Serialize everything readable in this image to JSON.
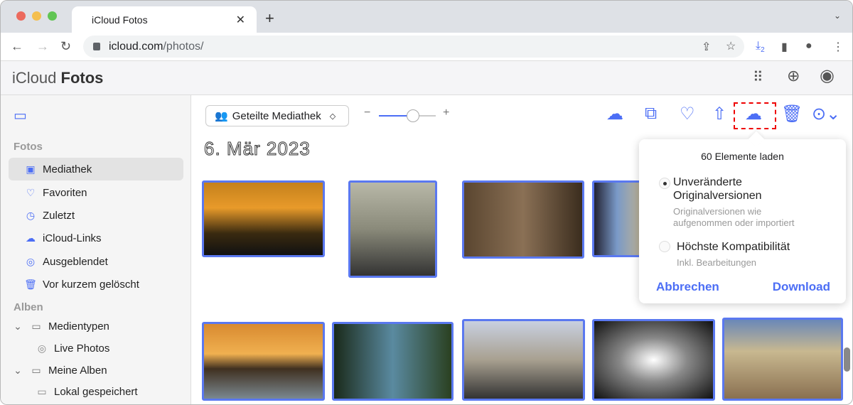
{
  "browser": {
    "tab_title": "iCloud Fotos",
    "url_host": "icloud.com",
    "url_path": "/photos/",
    "download_badge": "2"
  },
  "app": {
    "brand_prefix": "iCloud",
    "brand_name": "Fotos"
  },
  "sidebar": {
    "section_photos": "Fotos",
    "items": [
      {
        "label": "Mediathek",
        "icon": "photo-library-icon"
      },
      {
        "label": "Favoriten",
        "icon": "heart-icon"
      },
      {
        "label": "Zuletzt",
        "icon": "clock-icon"
      },
      {
        "label": "iCloud-Links",
        "icon": "link-icon"
      },
      {
        "label": "Ausgeblendet",
        "icon": "eye-slash-icon"
      },
      {
        "label": "Vor kurzem gelöscht",
        "icon": "trash-icon"
      }
    ],
    "section_albums": "Alben",
    "albums": [
      {
        "label": "Medientypen"
      },
      {
        "label": "Live Photos"
      },
      {
        "label": "Meine Alben"
      },
      {
        "label": "Lokal gespeichert"
      }
    ]
  },
  "toolbar": {
    "library_select": "Geteilte Mediathek",
    "zoom_level": 0.6
  },
  "main": {
    "date_heading": "6. Mär 2023"
  },
  "popover": {
    "title": "60 Elemente laden",
    "option1": "Unveränderte Originalversionen",
    "option1_sub": "Originalversionen wie aufgenommen oder importiert",
    "option2": "Höchste Kompatibilität",
    "option2_sub": "Inkl. Bearbeitungen",
    "cancel": "Abbrechen",
    "download": "Download"
  },
  "colors": {
    "accent": "#4c6ef5",
    "highlight": "#e00000"
  }
}
